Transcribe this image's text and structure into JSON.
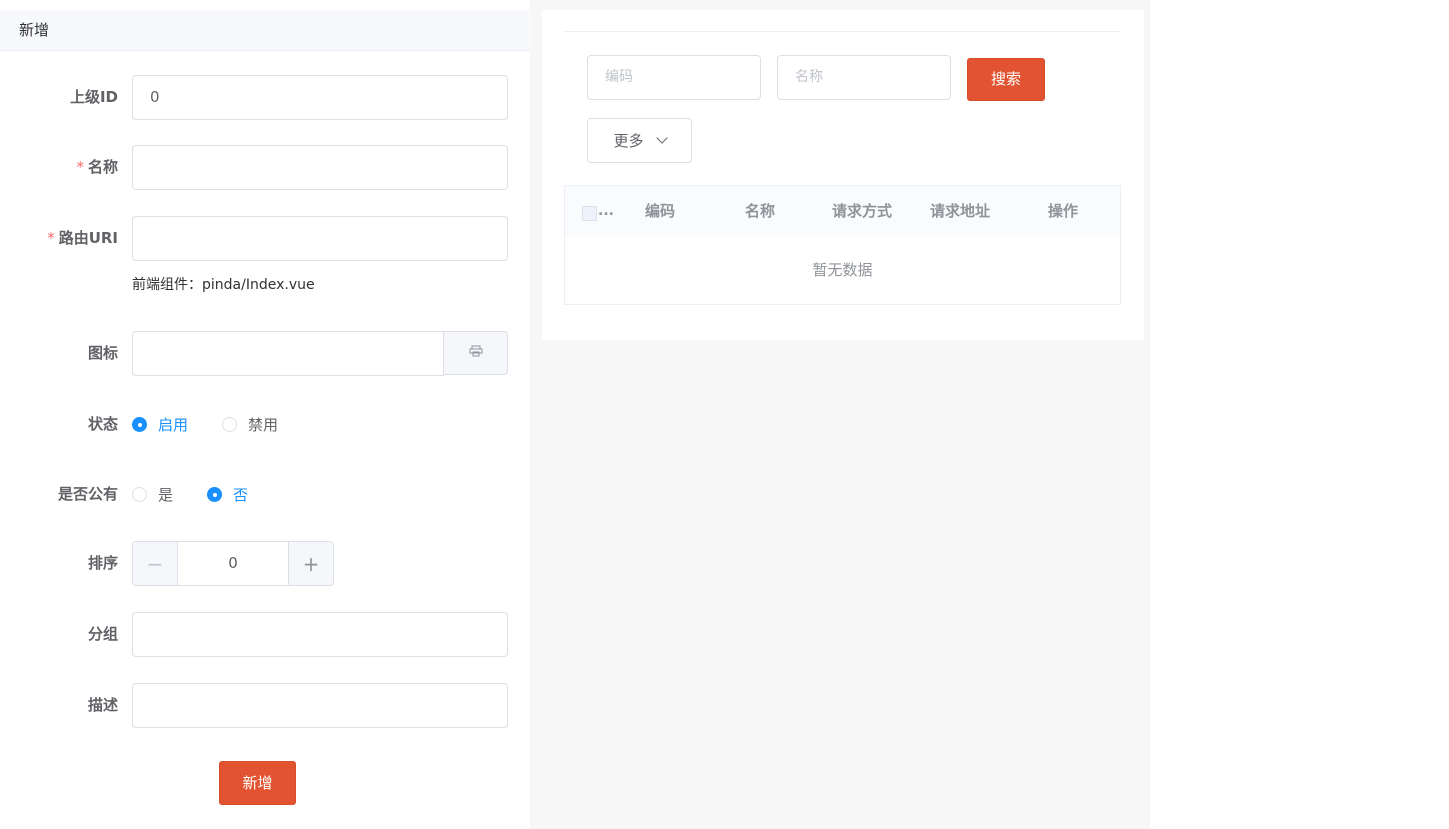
{
  "form": {
    "header": "新增",
    "parent_id": {
      "label": "上级ID",
      "value": "0"
    },
    "name": {
      "required_mark": "*",
      "label": "名称",
      "value": ""
    },
    "route": {
      "required_mark": "*",
      "label": "路由URI",
      "value": "",
      "hint": "前端组件：pinda/Index.vue"
    },
    "icon": {
      "label": "图标",
      "value": "",
      "append_icon": "icon-picker-icon"
    },
    "status": {
      "label": "状态",
      "options": [
        "启用",
        "禁用"
      ],
      "selected": "启用"
    },
    "is_public": {
      "label": "是否公有",
      "options": [
        "是",
        "否"
      ],
      "selected": "否"
    },
    "sort": {
      "label": "排序",
      "value": "0",
      "minus": "−",
      "plus": "+"
    },
    "group": {
      "label": "分组",
      "value": ""
    },
    "description": {
      "label": "描述",
      "value": ""
    },
    "submit_label": "新增"
  },
  "search": {
    "code_placeholder": "编码",
    "name_placeholder": "名称",
    "search_label": "搜索",
    "more_label": "更多"
  },
  "table": {
    "select_ellipsis": "...",
    "columns": [
      "编码",
      "名称",
      "请求方式",
      "请求地址",
      "操作"
    ],
    "empty_text": "暂无数据"
  },
  "colors": {
    "primary": "#e25431",
    "radio_checked": "#1890ff",
    "required": "#f56c6c"
  }
}
